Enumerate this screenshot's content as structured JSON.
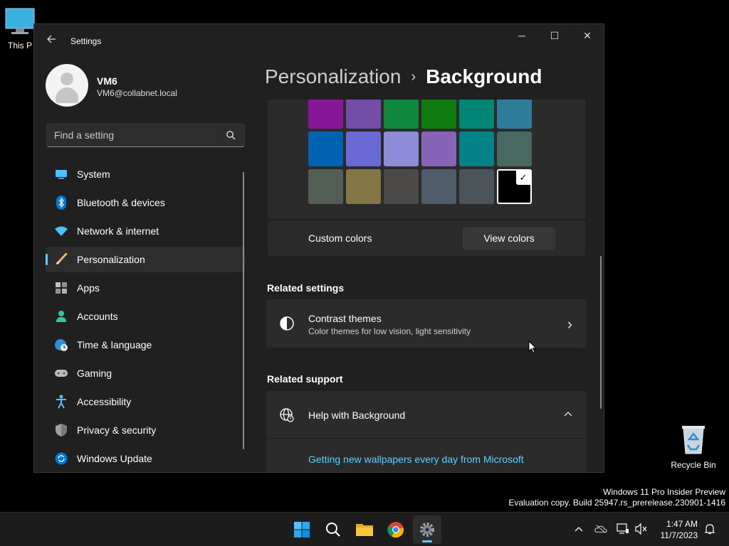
{
  "desktop": {
    "this_pc_label": "This P",
    "recycle_bin_label": "Recycle Bin"
  },
  "watermark": {
    "line1": "Windows 11 Pro Insider Preview",
    "line2": "Evaluation copy. Build 25947.rs_prerelease.230901-1416"
  },
  "window": {
    "title": "Settings",
    "controls": {
      "minimize": "─",
      "maximize": "☐",
      "close": "✕"
    }
  },
  "profile": {
    "name": "VM6",
    "email": "VM6@collabnet.local"
  },
  "search": {
    "placeholder": "Find a setting"
  },
  "nav": {
    "items": [
      {
        "label": "System",
        "icon": "system-icon"
      },
      {
        "label": "Bluetooth & devices",
        "icon": "bluetooth-icon"
      },
      {
        "label": "Network & internet",
        "icon": "wifi-icon"
      },
      {
        "label": "Personalization",
        "icon": "brush-icon",
        "selected": true
      },
      {
        "label": "Apps",
        "icon": "apps-icon"
      },
      {
        "label": "Accounts",
        "icon": "accounts-icon"
      },
      {
        "label": "Time & language",
        "icon": "globe-clock-icon"
      },
      {
        "label": "Gaming",
        "icon": "gamepad-icon"
      },
      {
        "label": "Accessibility",
        "icon": "accessibility-icon"
      },
      {
        "label": "Privacy & security",
        "icon": "shield-icon"
      },
      {
        "label": "Windows Update",
        "icon": "update-icon"
      }
    ]
  },
  "breadcrumb": {
    "parent": "Personalization",
    "separator": "›",
    "current": "Background"
  },
  "colors": {
    "swatches": [
      "#881798",
      "#744da9",
      "#10893e",
      "#107c10",
      "#018574",
      "#2d7d9a",
      "#0063b1",
      "#6b69d6",
      "#8e8cd8",
      "#8764b8",
      "#038387",
      "#486860",
      "#525e54",
      "#847545",
      "#4c4a48",
      "#515c6b",
      "#4a5459",
      "#000000"
    ],
    "selected_index": 17,
    "check": "✓",
    "custom_label": "Custom colors",
    "view_button": "View colors"
  },
  "related_settings": {
    "heading": "Related settings",
    "contrast_title": "Contrast themes",
    "contrast_subtitle": "Color themes for low vision, light sensitivity",
    "chevron": "›"
  },
  "related_support": {
    "heading": "Related support",
    "help_title": "Help with Background",
    "link": "Getting new wallpapers every day from Microsoft"
  },
  "taskbar": {
    "apps": [
      "start-icon",
      "search-icon",
      "file-explorer-icon",
      "chrome-icon",
      "settings-icon"
    ],
    "time": "1:47 AM",
    "date": "11/7/2023"
  },
  "accent": "#60cdff"
}
